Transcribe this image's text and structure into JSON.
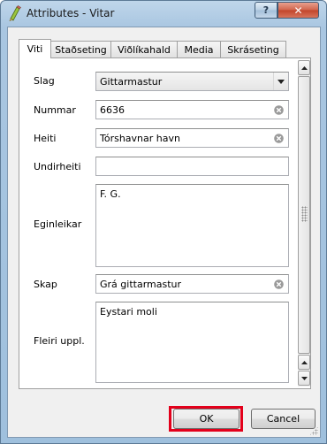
{
  "window": {
    "title": "Attributes - Vitar",
    "help_label": "?",
    "close_label": "✕",
    "icon": "qgis-pencil-icon"
  },
  "tabs": [
    {
      "label": "Viti",
      "active": true
    },
    {
      "label": "Staðseting",
      "active": false
    },
    {
      "label": "Viðlíkahald",
      "active": false
    },
    {
      "label": "Media",
      "active": false
    },
    {
      "label": "Skráseting",
      "active": false
    }
  ],
  "form": {
    "slag": {
      "label": "Slag",
      "value": "Gittarmastur"
    },
    "nummar": {
      "label": "Nummar",
      "value": "6636"
    },
    "heiti": {
      "label": "Heiti",
      "value": "Tórshavnar havn"
    },
    "undirheiti": {
      "label": "Undirheiti",
      "value": ""
    },
    "eginleikar": {
      "label": "Eginleikar",
      "value": "F. G."
    },
    "skap": {
      "label": "Skap",
      "value": "Grá gittarmastur"
    },
    "fleiri": {
      "label": "Fleiri uppl.",
      "value": "Eystari moli"
    }
  },
  "buttons": {
    "ok": "OK",
    "cancel": "Cancel"
  },
  "colors": {
    "highlight": "#e3001b",
    "close_button": "#c1442a"
  }
}
